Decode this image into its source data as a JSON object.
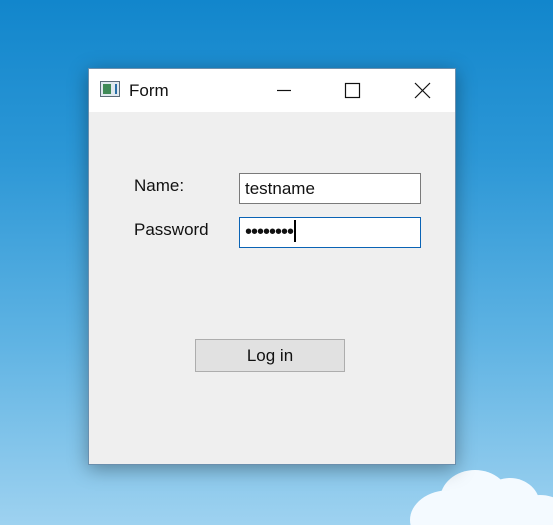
{
  "window": {
    "title": "Form",
    "icon": "form-app-icon",
    "controls": [
      "minimize-icon",
      "maximize-icon",
      "close-icon"
    ]
  },
  "form": {
    "name_label": "Name:",
    "name_value": "testname",
    "password_label": "Password",
    "password_mask": "••••••••",
    "login_label": "Log in"
  },
  "colors": {
    "desktop_top": "#1286cc",
    "desktop_bottom": "#9ed2f0",
    "window_bg": "#efefef",
    "focus_border": "#0a63b5",
    "button_bg": "#e1e1e1"
  }
}
